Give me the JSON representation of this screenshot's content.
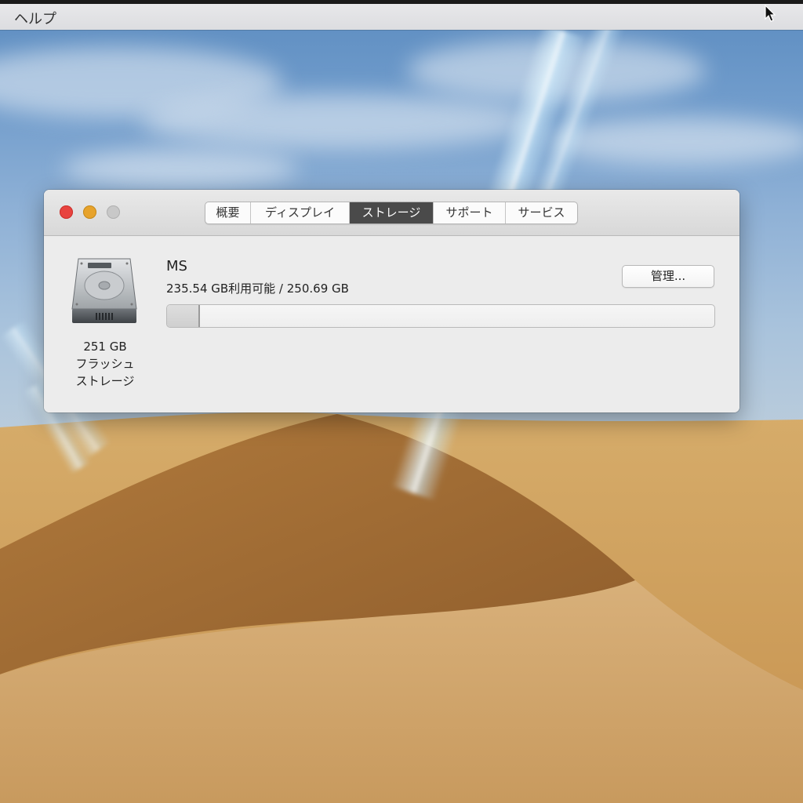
{
  "menubar": {
    "help_label": "ヘルプ"
  },
  "window": {
    "tabs": [
      {
        "label": "概要",
        "active": false
      },
      {
        "label": "ディスプレイ",
        "active": false
      },
      {
        "label": "ストレージ",
        "active": true
      },
      {
        "label": "サポート",
        "active": false
      },
      {
        "label": "サービス",
        "active": false
      }
    ],
    "drive": {
      "icon": "hard-drive-icon",
      "caption_line1": "251 GB",
      "caption_line2": "フラッシュ",
      "caption_line3": "ストレージ"
    },
    "volume": {
      "name": "MS",
      "capacity_text": "235.54 GB利用可能 / 250.69 GB",
      "available_gb": 235.54,
      "total_gb": 250.69,
      "used_fraction": 0.06
    },
    "manage_button_label": "管理..."
  },
  "colors": {
    "close": "#e8433f",
    "minimize": "#e7a32c",
    "zoom": "#c8c8c8",
    "active_tab": "#4a4a4a"
  }
}
